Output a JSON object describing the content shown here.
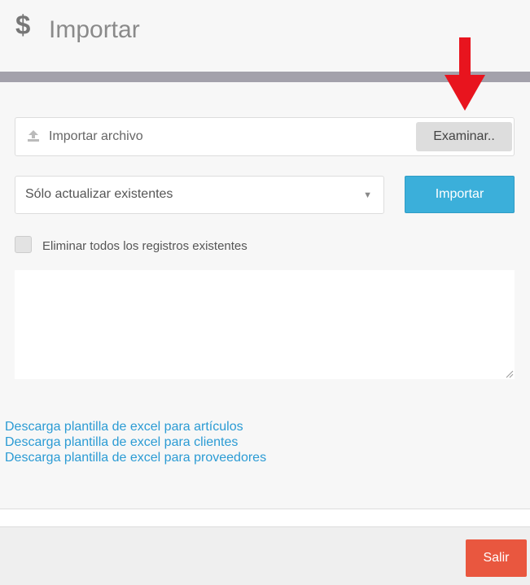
{
  "header": {
    "icon": "dollar-icon",
    "icon_glyph": "$",
    "title": "Importar"
  },
  "file_input": {
    "placeholder": "Importar archivo",
    "browse_label": "Examinar.."
  },
  "mode_select": {
    "selected": "Sólo actualizar existentes"
  },
  "import_button": {
    "label": "Importar"
  },
  "delete_checkbox": {
    "label": "Eliminar todos los registros existentes",
    "checked": false
  },
  "links": [
    "Descarga plantilla de excel para artículos",
    "Descarga plantilla de excel para clientes",
    "Descarga plantilla de excel para proveedores"
  ],
  "footer": {
    "exit_label": "Salir"
  },
  "colors": {
    "primary": "#3bafda",
    "danger": "#e9573f",
    "link": "#2b9bd4",
    "annotation_arrow": "#e8141e"
  }
}
